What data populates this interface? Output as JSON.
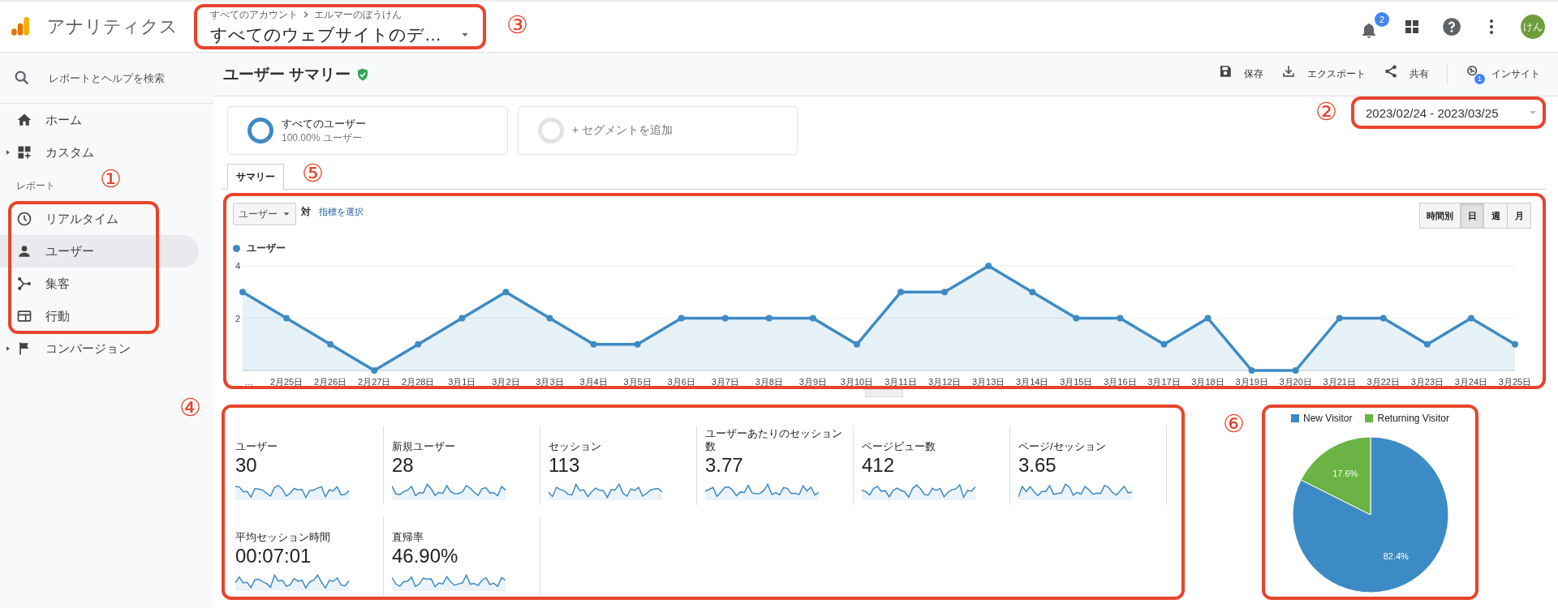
{
  "topbar": {
    "app_title": "アナリティクス",
    "account": {
      "breadcrumb": [
        "すべてのアカウント",
        "エルマーのぼうけん"
      ],
      "view": "すべてのウェブサイトのデ…",
      "callout": "③"
    },
    "notifications_badge": "2",
    "avatar": "けん"
  },
  "sidebar": {
    "search": {
      "placeholder": "レポートとヘルプを検索"
    },
    "items": [
      {
        "label": "ホーム",
        "kind": "link",
        "selected": false
      },
      {
        "label": "カスタム",
        "kind": "group",
        "selected": false
      }
    ],
    "section_title": "レポート",
    "reports": {
      "callout": "①",
      "items": [
        {
          "label": "リアルタイム",
          "kind": "link",
          "selected": false
        },
        {
          "label": "ユーザー",
          "kind": "link",
          "selected": true
        },
        {
          "label": "集客",
          "kind": "link",
          "selected": false
        },
        {
          "label": "行動",
          "kind": "link",
          "selected": false
        }
      ]
    },
    "items_after": [
      {
        "label": "コンバージョン",
        "kind": "group",
        "selected": false
      }
    ]
  },
  "page": {
    "title": "ユーザー サマリー",
    "actions": [
      {
        "label": "保存"
      },
      {
        "label": "エクスポート"
      },
      {
        "label": "共有"
      },
      {
        "label": "インサイト",
        "badge": "1"
      }
    ],
    "segments": [
      {
        "title": "すべてのユーザー",
        "subtitle": "100.00% ユーザー",
        "kind": "active"
      },
      {
        "title": "+ セグメントを追加",
        "kind": "add"
      }
    ],
    "date_range": {
      "text": "2023/02/24 - 2023/03/25",
      "callout": "②"
    },
    "tabs": [
      {
        "label": "サマリー",
        "selected": true
      }
    ],
    "chart": {
      "callout": "⑤",
      "metric": "ユーザー",
      "versus": "対",
      "select_metric": "指標を選択",
      "granularity": [
        {
          "label": "時間別",
          "selected": false
        },
        {
          "label": "日",
          "selected": true
        },
        {
          "label": "週",
          "selected": false
        },
        {
          "label": "月",
          "selected": false
        }
      ],
      "chart_data": {
        "type": "area",
        "categories": [
          "…",
          "2月25日",
          "2月26日",
          "2月27日",
          "2月28日",
          "3月1日",
          "3月2日",
          "3月3日",
          "3月4日",
          "3月5日",
          "3月6日",
          "3月7日",
          "3月8日",
          "3月9日",
          "3月10日",
          "3月11日",
          "3月12日",
          "3月13日",
          "3月14日",
          "3月15日",
          "3月16日",
          "3月17日",
          "3月18日",
          "3月19日",
          "3月20日",
          "3月21日",
          "3月22日",
          "3月23日",
          "3月24日",
          "3月25日"
        ],
        "series": [
          {
            "name": "ユーザー",
            "color": "#3d8bc4",
            "values": [
              3,
              2,
              1,
              0,
              1,
              2,
              3,
              2,
              1,
              1,
              2,
              2,
              2,
              2,
              1,
              3,
              3,
              4,
              3,
              2,
              2,
              1,
              2,
              0,
              0,
              2,
              2,
              1,
              2,
              1
            ]
          }
        ],
        "ylim": [
          0,
          4
        ],
        "yticks": [
          2,
          4
        ]
      }
    },
    "metrics": {
      "callout": "④",
      "items": [
        {
          "label": "ユーザー",
          "value": "30"
        },
        {
          "label": "新規ユーザー",
          "value": "28"
        },
        {
          "label": "セッション",
          "value": "113"
        },
        {
          "label": "ユーザーあたりのセッション数",
          "value": "3.77"
        },
        {
          "label": "ページビュー数",
          "value": "412"
        },
        {
          "label": "ページ/セッション",
          "value": "3.65"
        },
        {
          "label": "平均セッション時間",
          "value": "00:07:01"
        },
        {
          "label": "直帰率",
          "value": "46.90%"
        }
      ]
    },
    "pie": {
      "callout": "⑥",
      "chart_data": {
        "type": "pie",
        "categories": [
          "New Visitor",
          "Returning Visitor"
        ],
        "values": [
          82.4,
          17.6
        ],
        "colors": [
          "#3d8bc4",
          "#6ab344"
        ],
        "legend": "top",
        "value_labels": [
          "82.4%",
          "17.6%"
        ]
      }
    }
  }
}
